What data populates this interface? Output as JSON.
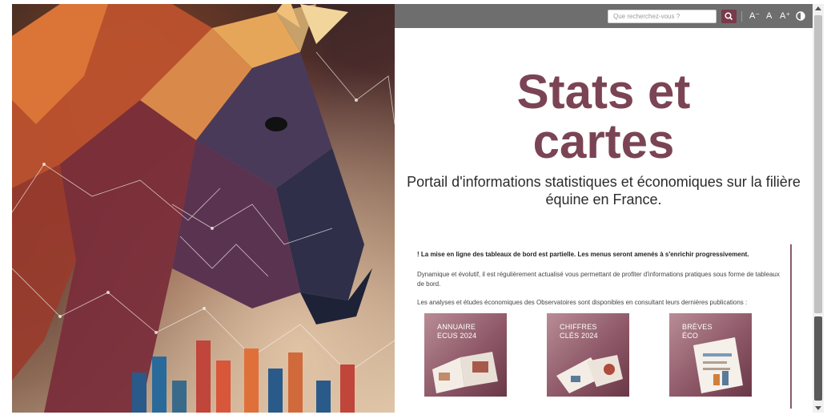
{
  "header": {
    "search": {
      "placeholder": "Que recherchez-vous ?",
      "value": ""
    },
    "search_button_icon": "search-icon",
    "accessibility": {
      "decrease_label": "A⁻",
      "normal_label": "A",
      "increase_label": "A⁺",
      "contrast_icon": "contrast-icon"
    }
  },
  "hero": {
    "image": "polygonal-horse-with-chart-artwork"
  },
  "main": {
    "title_line1": "Stats et",
    "title_line2": "cartes",
    "subtitle": "Portail d'informations statistiques et économiques sur la filière équine en France.",
    "notice": "! La mise en ligne des tableaux de bord est partielle. Les menus seront amenés à s'enrichir progressivement.",
    "paragraph1": "Dynamique et évolutif, il est régulièrement actualisé vous permettant de profiter d'informations pratiques sous forme de tableaux de bord.",
    "paragraph2": "Les analyses et études économiques des Observatoires sont disponibles en consultant leurs dernières publications :",
    "cards": [
      {
        "line1": "Annuaire",
        "line2": "ECUS 2024"
      },
      {
        "line1": "Chiffres",
        "line2": "clés 2024"
      },
      {
        "line1": "Brèves",
        "line2": "éco"
      }
    ]
  },
  "colors": {
    "brand": "#7b4455",
    "topbar": "#6e6e6e",
    "search_button": "#7a3a4a"
  }
}
